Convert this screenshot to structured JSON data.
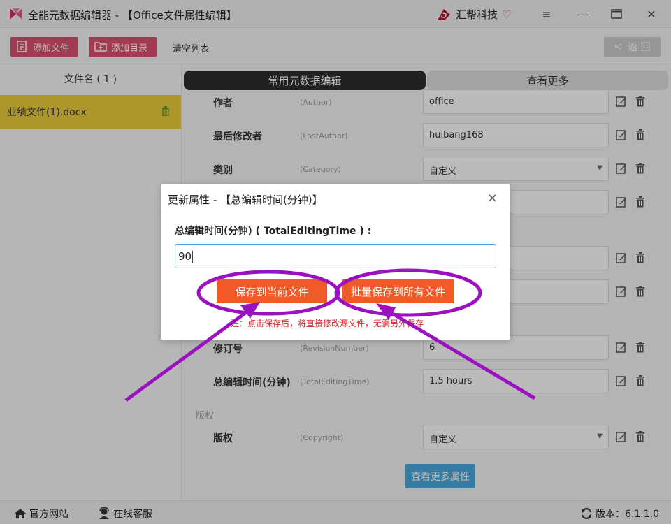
{
  "window": {
    "title": "全能元数据编辑器 - 【Office文件属性编辑】",
    "brand": "汇帮科技"
  },
  "toolbar": {
    "add_file": "添加文件",
    "add_dir": "添加目录",
    "clear_list": "清空列表",
    "back": "返 回"
  },
  "file_list": {
    "header": "文件名 ( 1 )",
    "files": [
      "业绩文件(1).docx"
    ]
  },
  "tabs": {
    "common": "常用元数据编辑",
    "more": "查看更多"
  },
  "properties": [
    {
      "label": "作者",
      "key": "(Author)",
      "value": "office",
      "type": "text"
    },
    {
      "label": "最后修改者",
      "key": "(LastAuthor)",
      "value": "huibang168",
      "type": "text"
    },
    {
      "label": "类别",
      "key": "(Category)",
      "value": "自定义",
      "type": "select"
    },
    {
      "label": "",
      "key": "",
      "value": "",
      "type": "text"
    },
    {
      "label": "",
      "key": "",
      "value": "",
      "type": "text"
    },
    {
      "label": "",
      "key": "",
      "value": "",
      "type": "text"
    },
    {
      "label": "修订号",
      "key": "(RevisionNumber)",
      "value": "6",
      "type": "text"
    },
    {
      "label": "总编辑时间(分钟)",
      "key": "(TotalEditingTime)",
      "value": "1.5 hours",
      "type": "text"
    }
  ],
  "copyright_section": {
    "title": "版权",
    "label": "版权",
    "key": "(Copyright)",
    "value": "自定义"
  },
  "more_props_button": "查看更多属性",
  "statusbar": {
    "website": "官方网站",
    "support": "在线客服",
    "version": "版本：6.1.1.0"
  },
  "dialog": {
    "title": "更新属性 - 【总编辑时间(分钟)】",
    "field_label": "总编辑时间(分钟) ( TotalEditingTime ) :",
    "field_value": "90",
    "save_current": "保存到当前文件",
    "save_all": "批量保存到所有文件",
    "note": "注：点击保存后，将直接修改源文件，无需另外保存"
  },
  "colors": {
    "toolbar_button": "#d94f6e",
    "selected_file": "#e6c93a",
    "save_button": "#f05a28",
    "annotation": "#9b10c0",
    "more_button": "#4aa6d8"
  }
}
